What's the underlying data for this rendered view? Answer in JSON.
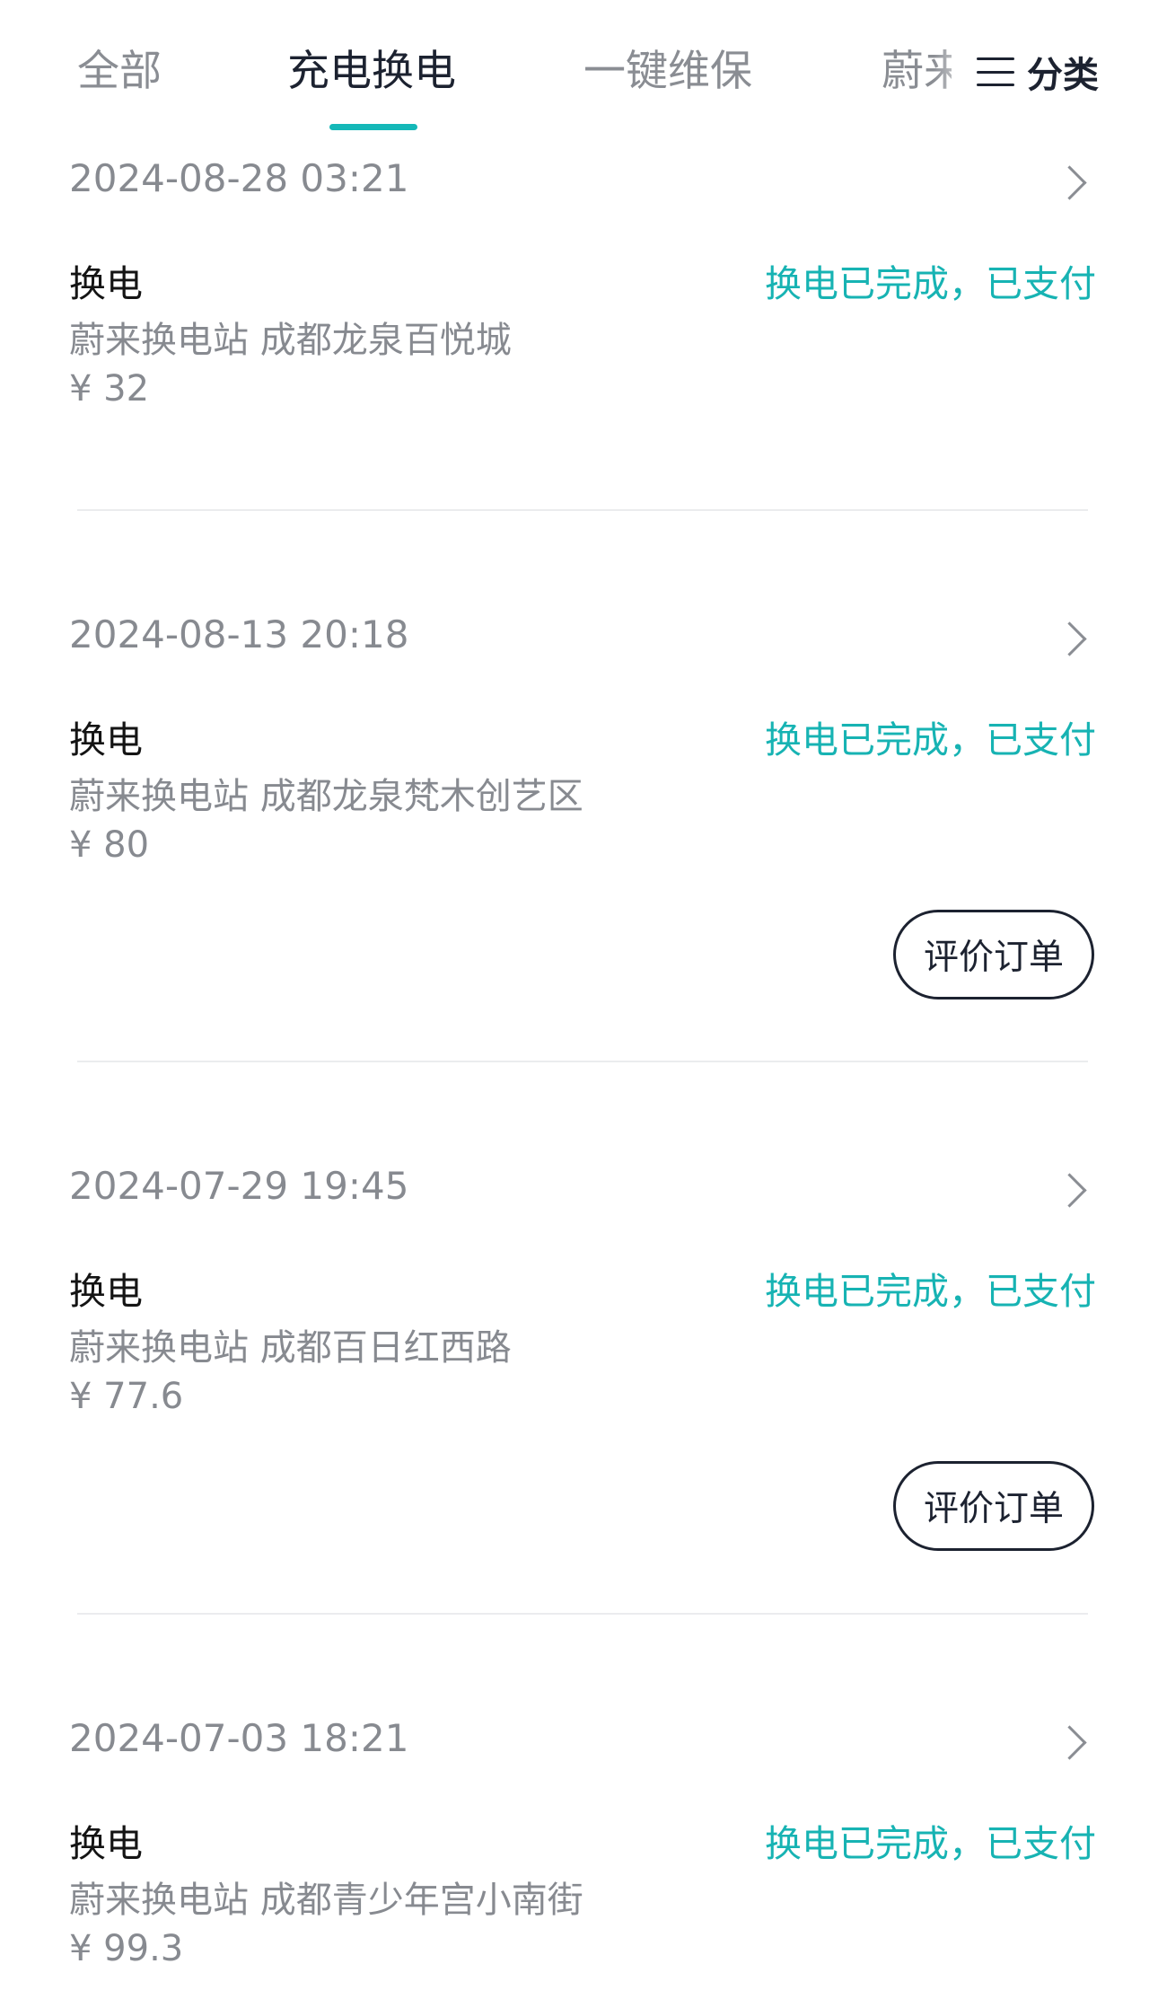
{
  "tabs": [
    {
      "label": "全部",
      "active": false
    },
    {
      "label": "充电换电",
      "active": true
    },
    {
      "label": "一键维保",
      "active": false
    },
    {
      "label": "蔚来",
      "active": false
    }
  ],
  "category": {
    "label": "分类"
  },
  "colors": {
    "accent": "#17b3b3",
    "text_primary": "#1c2230",
    "text_secondary": "#878a90",
    "divider": "#ebecee"
  },
  "orders": [
    {
      "date": "2024-08-28 03:21",
      "type": "换电",
      "status": "换电已完成，已支付",
      "station": "蔚来换电站 成都龙泉百悦城",
      "price": "¥ 32",
      "review_label": null
    },
    {
      "date": "2024-08-13 20:18",
      "type": "换电",
      "status": "换电已完成，已支付",
      "station": "蔚来换电站 成都龙泉梵木创艺区",
      "price": "¥ 80",
      "review_label": "评价订单"
    },
    {
      "date": "2024-07-29 19:45",
      "type": "换电",
      "status": "换电已完成，已支付",
      "station": "蔚来换电站 成都百日红西路",
      "price": "¥ 77.6",
      "review_label": "评价订单"
    },
    {
      "date": "2024-07-03 18:21",
      "type": "换电",
      "status": "换电已完成，已支付",
      "station": "蔚来换电站 成都青少年宫小南街",
      "price": "¥ 99.3",
      "review_label": null
    }
  ]
}
